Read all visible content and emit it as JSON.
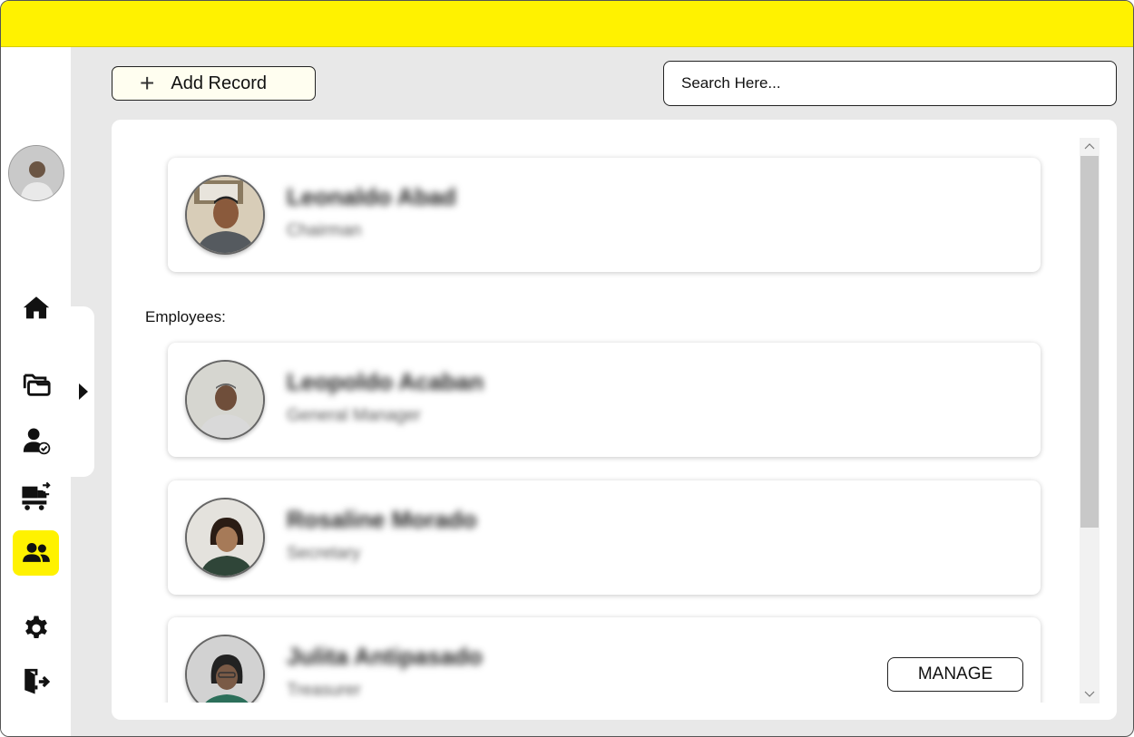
{
  "toolbar": {
    "add_record_label": "Add Record",
    "search_placeholder": "Search Here..."
  },
  "sidebar": {
    "items": [
      {
        "name": "home",
        "icon": "home-icon"
      },
      {
        "name": "records",
        "icon": "folders-icon"
      },
      {
        "name": "users",
        "icon": "user-check-icon"
      },
      {
        "name": "transactions",
        "icon": "truck-exchange-icon"
      },
      {
        "name": "employees",
        "icon": "people-icon",
        "active": true
      },
      {
        "name": "settings",
        "icon": "gear-icon"
      },
      {
        "name": "logout",
        "icon": "logout-icon"
      }
    ]
  },
  "head_card": {
    "name": "Leonaldo Abad",
    "role": "Chairman"
  },
  "employees_label": "Employees:",
  "employees": [
    {
      "name": "Leopoldo Acaban",
      "role": "General Manager"
    },
    {
      "name": "Rosaline Morado",
      "role": "Secretary"
    },
    {
      "name": "Julita Antipasado",
      "role": "Treasurer"
    }
  ],
  "manage_label": "MANAGE",
  "colors": {
    "accent": "#fff200",
    "background": "#e8e8e8"
  }
}
